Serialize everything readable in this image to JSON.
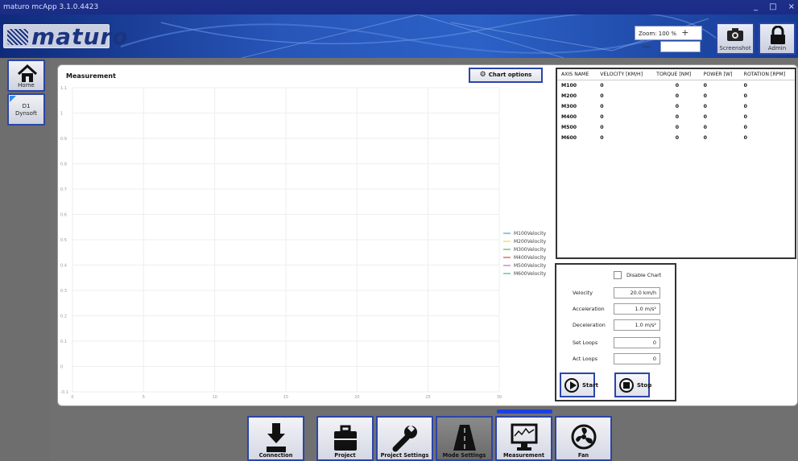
{
  "window": {
    "title": "maturo mcApp 3.1.0.4423",
    "controls": [
      "_",
      "□",
      "×"
    ]
  },
  "header": {
    "logo_text": "maturo",
    "zoom_label": "Zoom: 100 %",
    "zoom_plus": "+",
    "zoom_minus": "—",
    "screenshot_label": "Screenshot",
    "admin_label": "Admin"
  },
  "sidebar": {
    "home_label": "Home",
    "device_label_1": "D1",
    "device_label_2": "Dynsoft"
  },
  "measurement": {
    "title": "Measurement",
    "chart_options_label": "Chart options"
  },
  "chart_data": {
    "type": "line",
    "x": [
      0,
      5,
      10,
      15,
      20,
      25,
      30
    ],
    "xlim": [
      0,
      30
    ],
    "ylim": [
      -0.1,
      1.1
    ],
    "y_ticks": [
      "1.1",
      "1",
      "0.9",
      "0.8",
      "0.7",
      "0.6",
      "0.5",
      "0.4",
      "0.3",
      "0.2",
      "0.1",
      "0",
      "-0.1"
    ],
    "x_ticks": [
      "0",
      "5",
      "10",
      "15",
      "20",
      "25",
      "30"
    ],
    "grid": true,
    "legend_position": "right",
    "series": [
      {
        "name": "M100Velocity",
        "color": "#3aa6d8",
        "values": []
      },
      {
        "name": "M200Velocity",
        "color": "#e6d84a",
        "values": []
      },
      {
        "name": "M300Velocity",
        "color": "#52b84f",
        "values": []
      },
      {
        "name": "M400Velocity",
        "color": "#d84a4a",
        "values": []
      },
      {
        "name": "M500Velocity",
        "color": "#c46ad0",
        "values": []
      },
      {
        "name": "M600Velocity",
        "color": "#3ab8b0",
        "values": []
      }
    ]
  },
  "axis_table": {
    "headers": [
      "AXIS NAME",
      "VELOCITY [KM/H]",
      "TORQUE [NM]",
      "POWER [W]",
      "ROTATION [RPM]"
    ],
    "rows": [
      [
        "M100",
        "0",
        "0",
        "0",
        "0"
      ],
      [
        "M200",
        "0",
        "0",
        "0",
        "0"
      ],
      [
        "M300",
        "0",
        "0",
        "0",
        "0"
      ],
      [
        "M400",
        "0",
        "0",
        "0",
        "0"
      ],
      [
        "M500",
        "0",
        "0",
        "0",
        "0"
      ],
      [
        "M600",
        "0",
        "0",
        "0",
        "0"
      ]
    ]
  },
  "controls": {
    "disable_chart_label": "Disable Chart",
    "disable_chart_checked": false,
    "velocity_label": "Velocity",
    "velocity_value": "20.0 km/h",
    "acceleration_label": "Acceleration",
    "acceleration_value": "1.0 m/s²",
    "deceleration_label": "Deceleration",
    "deceleration_value": "1.0 m/s²",
    "set_loops_label": "Set Loops",
    "set_loops_value": "0",
    "act_loops_label": "Act Loops",
    "act_loops_value": "0",
    "start_label": "Start",
    "stop_label": "Stop"
  },
  "bottom_nav": {
    "items": [
      "Connection",
      "Project",
      "Project Settings",
      "Mode Settings",
      "Measurement",
      "Fan"
    ],
    "active": "Mode Settings",
    "selected_tab": "Measurement"
  }
}
